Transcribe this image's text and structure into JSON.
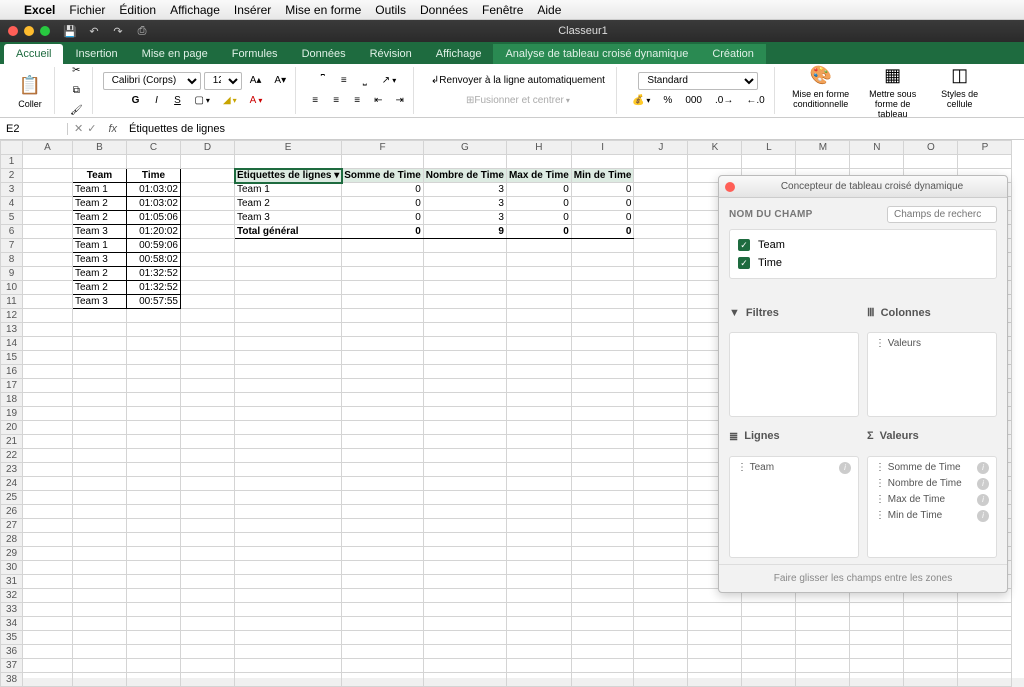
{
  "mac_menu": {
    "apple": "",
    "app": "Excel",
    "items": [
      "Fichier",
      "Édition",
      "Affichage",
      "Insérer",
      "Mise en forme",
      "Outils",
      "Données",
      "Fenêtre",
      "Aide"
    ]
  },
  "window": {
    "title": "Classeur1"
  },
  "ribbon_tabs": [
    "Accueil",
    "Insertion",
    "Mise en page",
    "Formules",
    "Données",
    "Révision",
    "Affichage",
    "Analyse de tableau croisé dynamique",
    "Création"
  ],
  "ribbon": {
    "paste": "Coller",
    "font_name": "Calibri (Corps)",
    "font_size": "12",
    "wrap": "Renvoyer à la ligne automatiquement",
    "merge": "Fusionner et centrer",
    "num_format": "Standard",
    "cond": "Mise en forme conditionnelle",
    "tbl": "Mettre sous forme de tableau",
    "cell": "Styles de cellule"
  },
  "formula": {
    "cell": "E2",
    "value": "Étiquettes de lignes"
  },
  "columns": [
    "A",
    "B",
    "C",
    "D",
    "E",
    "F",
    "G",
    "H",
    "I",
    "J",
    "K",
    "L",
    "M",
    "N",
    "O",
    "P"
  ],
  "data_table": {
    "headers": [
      "Team",
      "Time"
    ],
    "rows": [
      [
        "Team 1",
        "01:03:02"
      ],
      [
        "Team 2",
        "01:03:02"
      ],
      [
        "Team 2",
        "01:05:06"
      ],
      [
        "Team 3",
        "01:20:02"
      ],
      [
        "Team 1",
        "00:59:06"
      ],
      [
        "Team 3",
        "00:58:02"
      ],
      [
        "Team 2",
        "01:32:52"
      ],
      [
        "Team 2",
        "01:32:52"
      ],
      [
        "Team 3",
        "00:57:55"
      ]
    ]
  },
  "pivot_table": {
    "row_label": "Étiquettes de lignes",
    "cols": [
      "Somme de Time",
      "Nombre de Time",
      "Max de Time",
      "Min de Time"
    ],
    "rows": [
      {
        "label": "Team 1",
        "v": [
          "0",
          "3",
          "0",
          "0"
        ]
      },
      {
        "label": "Team 2",
        "v": [
          "0",
          "3",
          "0",
          "0"
        ]
      },
      {
        "label": "Team 3",
        "v": [
          "0",
          "3",
          "0",
          "0"
        ]
      }
    ],
    "total": {
      "label": "Total général",
      "v": [
        "0",
        "9",
        "0",
        "0"
      ]
    }
  },
  "pivot_panel": {
    "title": "Concepteur de tableau croisé dynamique",
    "field_label": "NOM DU CHAMP",
    "search_placeholder": "Champs de recherc",
    "fields": [
      "Team",
      "Time"
    ],
    "areas": {
      "filters": "Filtres",
      "columns": "Colonnes",
      "rows": "Lignes",
      "values": "Valeurs",
      "cols_items": [
        "Valeurs"
      ],
      "rows_items": [
        "Team"
      ],
      "values_items": [
        "Somme de Time",
        "Nombre de Time",
        "Max de Time",
        "Min de Time"
      ]
    },
    "footer": "Faire glisser les champs entre les zones"
  }
}
